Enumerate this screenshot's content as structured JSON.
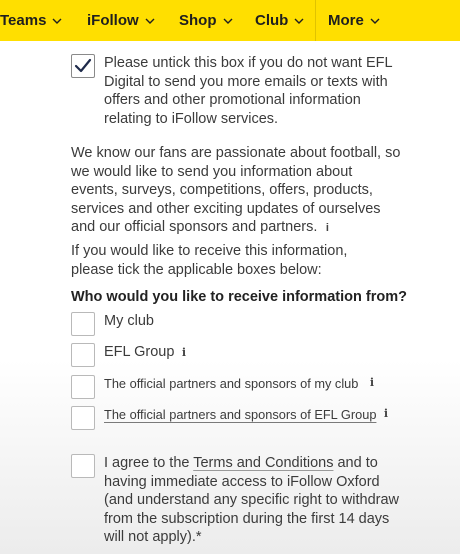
{
  "nav": {
    "items": [
      {
        "label": "Teams"
      },
      {
        "label": "iFollow"
      },
      {
        "label": "Shop"
      },
      {
        "label": "Club"
      },
      {
        "label": "More"
      }
    ]
  },
  "marketing_optout": {
    "checked": true,
    "text": "Please untick this box if you do not want EFL Digital to send you more emails or texts with offers and other promotional information relating to iFollow services."
  },
  "intro": {
    "paragraph": "We know our fans are passionate about football, so we would like to send you information about events, surveys, competitions, offers, products, services and other exciting updates of ourselves and our official sponsors and partners.",
    "info_glyph": "i",
    "instruction": "If you would like to receive this information, please tick the applicable boxes below:"
  },
  "preferences": {
    "heading": "Who would you like to receive information from?",
    "options": [
      {
        "label": "My club",
        "checked": false
      },
      {
        "label": "EFL Group",
        "checked": false
      },
      {
        "label": "The official partners and sponsors of my club",
        "checked": false
      },
      {
        "label": "The official partners and sponsors of EFL Group",
        "checked": false
      }
    ]
  },
  "terms": {
    "checked": false,
    "prefix": "I agree to the ",
    "link": "Terms and Conditions",
    "suffix": " and to having immediate access to iFollow Oxford (and understand any specific right to withdraw from the subscription during the first 14 days will not apply).*"
  }
}
